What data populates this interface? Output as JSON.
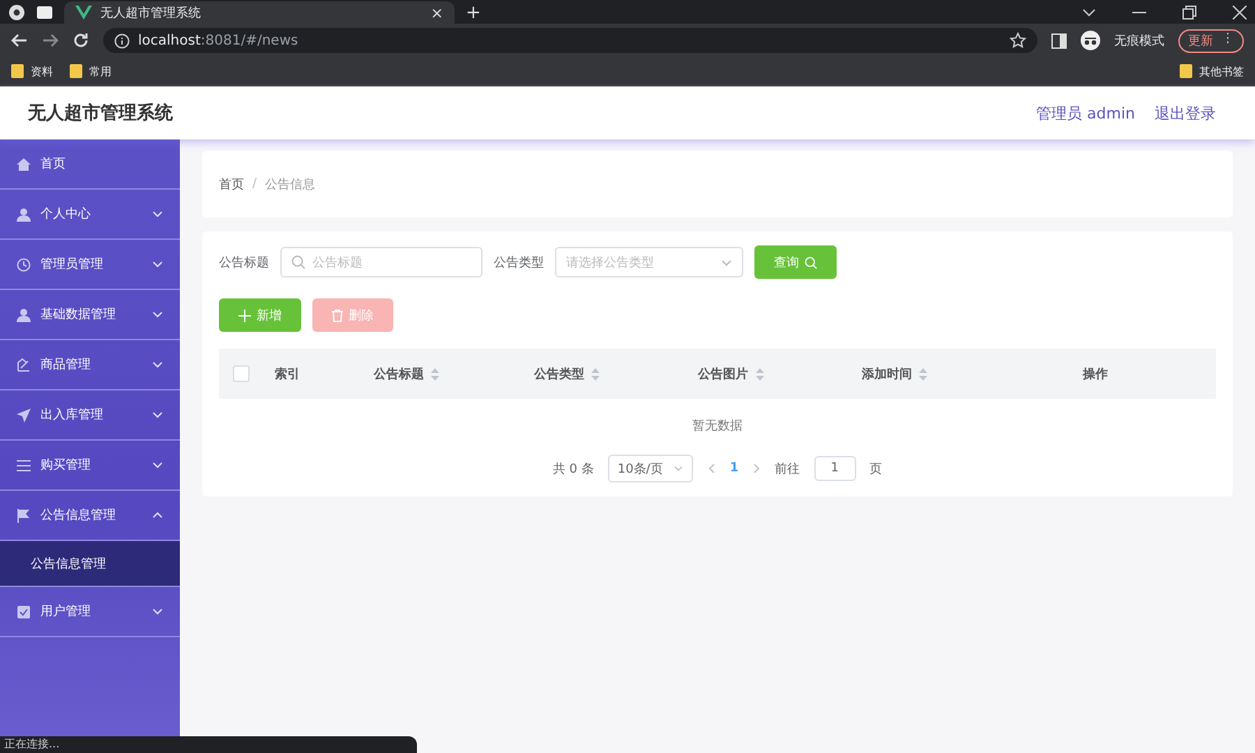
{
  "browser": {
    "tab_title": "无人超市管理系统",
    "tab_close": "×",
    "new_tab": "+",
    "url_host": "localhost",
    "url_rest": ":8081/#/news",
    "profile": "无痕模式",
    "update_button": "更新",
    "update_menu": "⋮",
    "bookmarks": [
      "资料",
      "常用"
    ],
    "other_bookmarks": "其他书签",
    "status_text": "正在连接..."
  },
  "header": {
    "title": "无人超市管理系统",
    "user": "管理员 admin",
    "logout": "退出登录"
  },
  "sidebar": {
    "items": [
      {
        "label": "首页",
        "has_children": false
      },
      {
        "label": "个人中心",
        "expanded": false,
        "has_children": true
      },
      {
        "label": "管理员管理",
        "expanded": false,
        "has_children": true
      },
      {
        "label": "基础数据管理",
        "expanded": false,
        "has_children": true
      },
      {
        "label": "商品管理",
        "expanded": false,
        "has_children": true
      },
      {
        "label": "出入库管理",
        "expanded": false,
        "has_children": true
      },
      {
        "label": "购买管理",
        "expanded": false,
        "has_children": true
      },
      {
        "label": "公告信息管理",
        "expanded": true,
        "has_children": true,
        "children": [
          {
            "label": "公告信息管理",
            "selected": true
          }
        ]
      },
      {
        "label": "用户管理",
        "expanded": false,
        "has_children": true
      }
    ]
  },
  "breadcrumb": {
    "separator": "/",
    "items": [
      "首页",
      "公告信息"
    ]
  },
  "filters": [
    {
      "label": "公告标题",
      "kind": "search",
      "placeholder": "公告标题"
    },
    {
      "label": "公告类型",
      "kind": "select",
      "placeholder": "请选择公告类型"
    }
  ],
  "query_button": "查询",
  "actions": [
    {
      "label": "新增",
      "kind": "add",
      "disabled": false
    },
    {
      "label": "删除",
      "kind": "delete",
      "disabled": true
    }
  ],
  "table": {
    "select_all": {
      "checked": false
    },
    "columns": [
      {
        "label": "索引",
        "sortable": false
      },
      {
        "label": "公告标题",
        "sortable": true
      },
      {
        "label": "公告类型",
        "sortable": true
      },
      {
        "label": "公告图片",
        "sortable": true
      },
      {
        "label": "添加时间",
        "sortable": true
      },
      {
        "label": "操作",
        "sortable": false
      }
    ],
    "empty_text": "暂无数据"
  },
  "pagination": {
    "total": "共 0 条",
    "page_size": "10条/页",
    "pages": [
      {
        "label": "1",
        "selected": true
      }
    ],
    "goto_label": "前往",
    "goto_value": "1",
    "goto_suffix": "页"
  }
}
